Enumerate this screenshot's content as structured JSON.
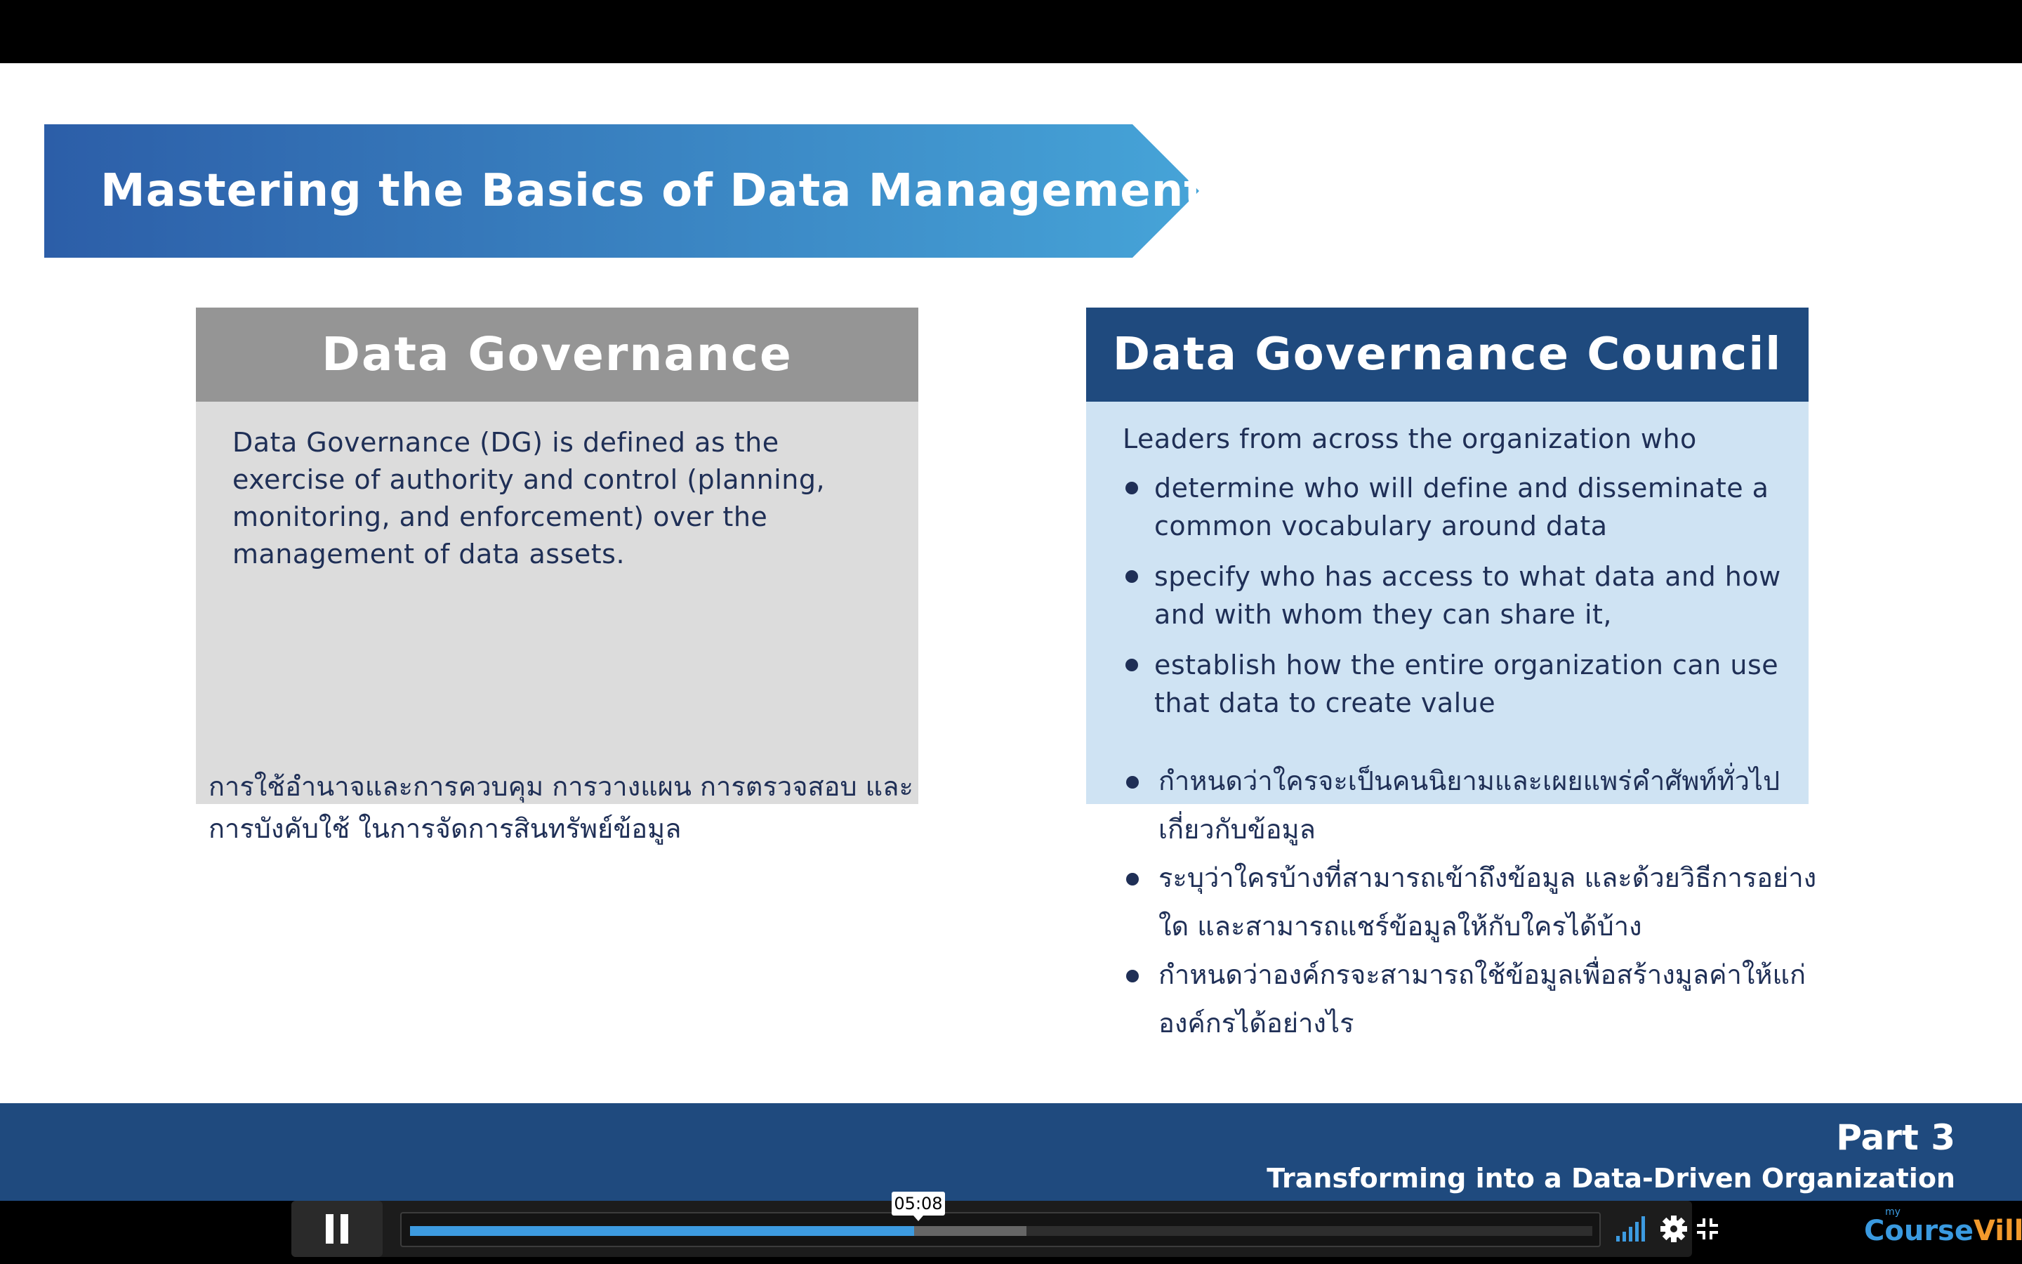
{
  "slide": {
    "title": "Mastering the Basics of Data Management",
    "left": {
      "header": "Data Governance",
      "body": "Data Governance (DG) is defined as the exercise of authority and control (planning, monitoring, and enforcement) over the management of data assets.",
      "thai": "การใช้อำนาจและการควบคุม การวางแผน การตรวจสอบ และการบังคับใช้ ในการจัดการสินทรัพย์ข้อมูล"
    },
    "right": {
      "header": "Data Governance Council",
      "intro": "Leaders from across the organization who",
      "bullets": [
        "determine who will define and disseminate a common vocabulary around data",
        "specify who has access to what data and how and with whom they can share it,",
        "establish how the entire organization can use that data to create value"
      ],
      "thai_bullets": [
        "กำหนดว่าใครจะเป็นคนนิยามและเผยแพร่คำศัพท์ทั่วไปเกี่ยวกับข้อมูล",
        "ระบุว่าใครบ้างที่สามารถเข้าถึงข้อมูล และด้วยวิธีการอย่างใด และสามารถแชร์ข้อมูลให้กับใครได้บ้าง",
        "กำหนดว่าองค์กรจะสามารถใช้ข้อมูลเพื่อสร้างมูลค่าให้แก่องค์กรได้อย่างไร"
      ]
    },
    "footer": {
      "part": "Part 3",
      "subtitle": "Transforming into a Data-Driven Organization"
    }
  },
  "player": {
    "current_time": "05:08",
    "played_fraction": 0.4265,
    "buffered_fraction": 0.5216,
    "icons": [
      "pause-icon",
      "volume-icon",
      "gear-icon",
      "fullscreen-exit-icon"
    ]
  },
  "logo": {
    "small": "my",
    "brand_part1": "Course",
    "brand_part2": "Ville"
  },
  "colors": {
    "navy": "#1f4a7e",
    "gray_header": "#959595",
    "light_blue": "#cfe3f3",
    "progress": "#3d9be0"
  }
}
